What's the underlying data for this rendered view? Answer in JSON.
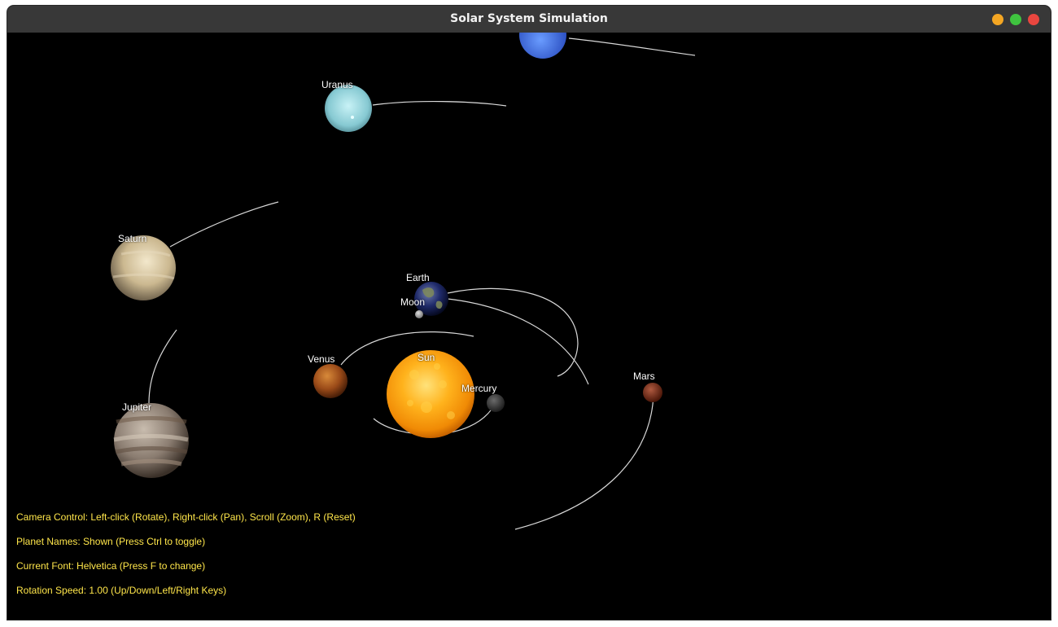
{
  "window": {
    "title": "Solar System Simulation",
    "controls": {
      "minimize_color": "#F4A623",
      "maximize_color": "#3FC33F",
      "close_color": "#E9463F"
    }
  },
  "planet_labels": {
    "sun": "Sun",
    "mercury": "Mercury",
    "venus": "Venus",
    "earth": "Earth",
    "moon": "Moon",
    "mars": "Mars",
    "jupiter": "Jupiter",
    "saturn": "Saturn",
    "uranus": "Uranus"
  },
  "hud": {
    "camera_control": "Camera Control: Left-click (Rotate), Right-click (Pan), Scroll (Zoom), R (Reset)",
    "planet_names": "Planet Names: Shown (Press Ctrl to toggle)",
    "current_font": "Current Font: Helvetica (Press F to change)",
    "rotation_speed": "Rotation Speed: 1.00 (Up/Down/Left/Right Keys)",
    "text_color": "#FFE64A"
  },
  "colors": {
    "background": "#000000",
    "orbit_line": "#D8D8D8",
    "titlebar": "#383838"
  }
}
